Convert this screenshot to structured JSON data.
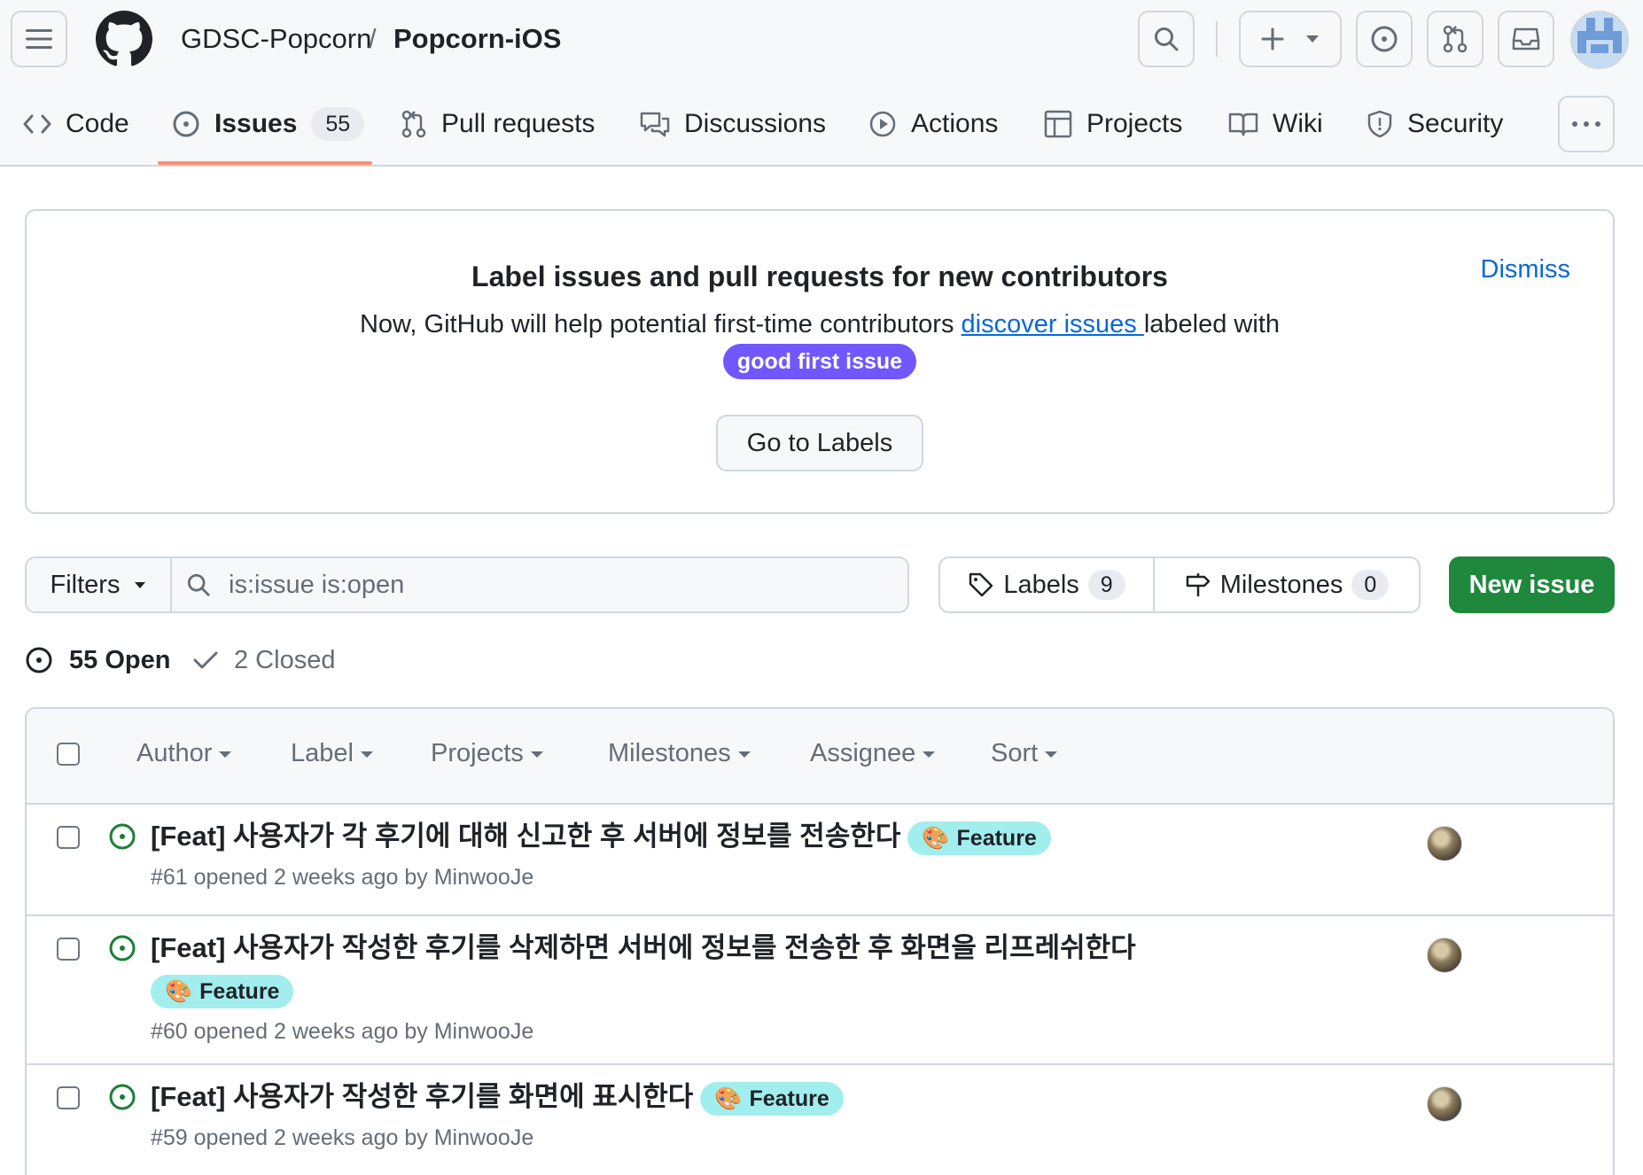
{
  "header": {
    "owner": "GDSC-Popcorn",
    "separator": "/",
    "repo": "Popcorn-iOS"
  },
  "tabs": [
    {
      "label": "Code",
      "icon": "code-icon"
    },
    {
      "label": "Issues",
      "icon": "issue-opened-icon",
      "count": "55",
      "active": true
    },
    {
      "label": "Pull requests",
      "icon": "git-pull-request-icon"
    },
    {
      "label": "Discussions",
      "icon": "comment-discussion-icon"
    },
    {
      "label": "Actions",
      "icon": "play-icon"
    },
    {
      "label": "Projects",
      "icon": "table-icon"
    },
    {
      "label": "Wiki",
      "icon": "book-icon"
    },
    {
      "label": "Security",
      "icon": "shield-icon"
    }
  ],
  "banner": {
    "title": "Label issues and pull requests for new contributors",
    "dismiss": "Dismiss",
    "text_before": "Now, GitHub will help potential first-time contributors ",
    "link": "discover issues ",
    "text_after": "labeled with",
    "label": "good first issue",
    "button": "Go to Labels"
  },
  "filters": {
    "filters_label": "Filters",
    "search_value": "is:issue is:open",
    "labels_label": "Labels",
    "labels_count": "9",
    "milestones_label": "Milestones",
    "milestones_count": "0",
    "new_issue": "New issue"
  },
  "state": {
    "open": "55 Open",
    "closed": "2 Closed"
  },
  "list_header": {
    "author": "Author",
    "label": "Label",
    "projects": "Projects",
    "milestones": "Milestones",
    "assignee": "Assignee",
    "sort": "Sort"
  },
  "issues": [
    {
      "title": "[Feat] 사용자가 각 후기에 대해 신고한 후 서버에 정보를 전송한다",
      "label": "Feature",
      "meta": "#61 opened 2 weeks ago by MinwooJe"
    },
    {
      "title": "[Feat] 사용자가 작성한 후기를 삭제하면 서버에 정보를 전송한 후 화면을 리프레쉬한다",
      "label": "Feature",
      "meta": "#60 opened 2 weeks ago by MinwooJe"
    },
    {
      "title": "[Feat] 사용자가 작성한 후기를 화면에 표시한다",
      "label": "Feature",
      "meta": "#59 opened 2 weeks ago by MinwooJe"
    }
  ],
  "colors": {
    "accent": "#0969da",
    "new_issue_green": "#1f883d",
    "good_first_issue": "#7057ff",
    "feature_label": "#a2eeef",
    "open_icon": "#1a7f37",
    "tab_underline": "#fd8c73"
  }
}
